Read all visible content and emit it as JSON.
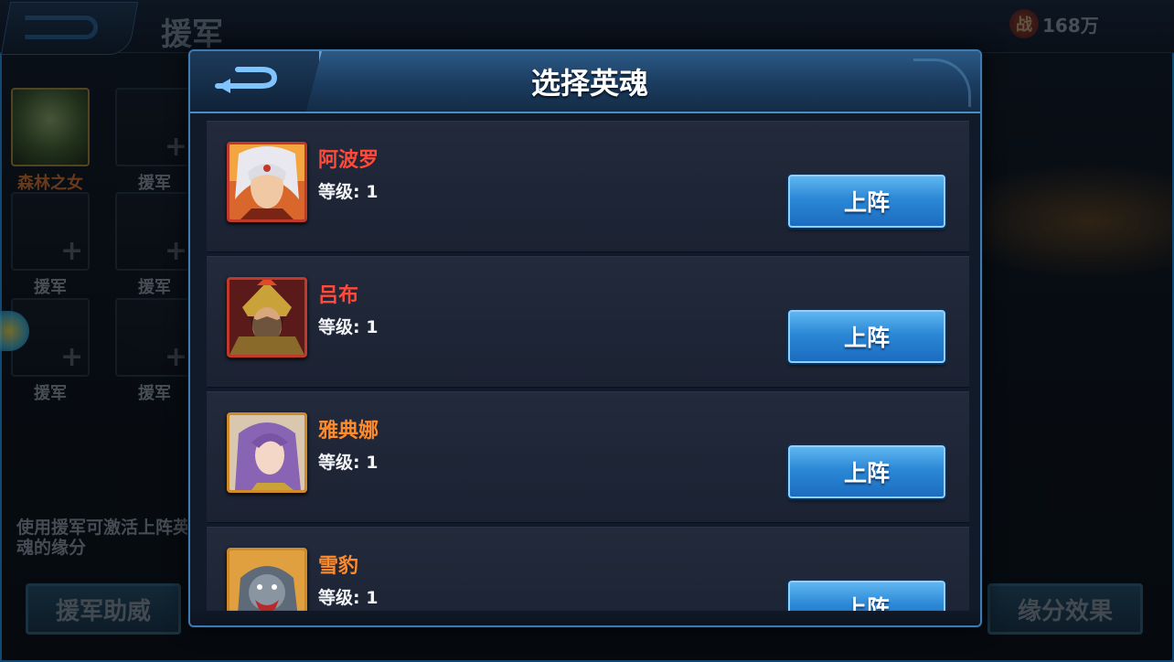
{
  "background": {
    "page_title": "援军",
    "power": {
      "icon_text": "战",
      "value": "168万"
    },
    "slots": [
      {
        "label": "森林之女",
        "filled": true
      },
      {
        "label": "援军",
        "filled": false
      },
      {
        "label": "援军",
        "filled": false
      },
      {
        "label": "援军",
        "filled": false
      },
      {
        "label": "援军",
        "filled": false
      },
      {
        "label": "援军",
        "filled": false
      }
    ],
    "description": "使用援军可激活上阵英魂的缘分",
    "left_button": "援军助威",
    "right_button": "缘分效果"
  },
  "modal": {
    "title": "选择英魂",
    "level_label": "等级:",
    "deploy_label": "上阵",
    "heroes": [
      {
        "name": "阿波罗",
        "level": "1",
        "name_color": "#ff4a3a",
        "frame_color": "#c0392b",
        "portrait": "apollo-portrait"
      },
      {
        "name": "吕布",
        "level": "1",
        "name_color": "#ff4a3a",
        "frame_color": "#c0392b",
        "portrait": "lubu-portrait"
      },
      {
        "name": "雅典娜",
        "level": "1",
        "name_color": "#ff8a2a",
        "frame_color": "#d08a2a",
        "portrait": "athena-portrait"
      },
      {
        "name": "雪豹",
        "level": "1",
        "name_color": "#ff8a2a",
        "frame_color": "#d08a2a",
        "portrait": "snow-leopard-portrait"
      }
    ]
  }
}
